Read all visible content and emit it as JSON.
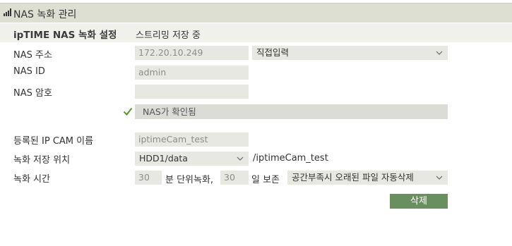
{
  "header": {
    "title": "NAS 녹화 관리",
    "icon": "bar-chart-icon"
  },
  "subheader": {
    "section": "ipTIME NAS 녹화 설정",
    "status": "스트리밍 저장 중"
  },
  "form": {
    "nas_address": {
      "label": "NAS 주소",
      "value": "172.20.10.249",
      "mode_select": "직접입력"
    },
    "nas_id": {
      "label": "NAS ID",
      "value": "admin"
    },
    "nas_password": {
      "label": "NAS 암호",
      "value": ""
    },
    "confirm_message": "NAS가 확인됨",
    "camera_name": {
      "label": "등록된 IP CAM 이름",
      "value": "iptimeCam_test"
    },
    "save_location": {
      "label": "녹화 저장 위치",
      "select": "HDD1/data",
      "path": "/iptimeCam_test"
    },
    "record_time": {
      "label": "녹화 시간",
      "unit_minutes": "30",
      "unit_text": "분 단위녹화,",
      "keep_days": "30",
      "keep_text": "일 보존",
      "policy_select": "공간부족시 오래된 파일 자동삭제"
    }
  },
  "buttons": {
    "delete": "삭제"
  },
  "colors": {
    "accent_green": "#6a8f5e",
    "check_green": "#5e9a3a",
    "header_bg": "#dedfd3"
  }
}
